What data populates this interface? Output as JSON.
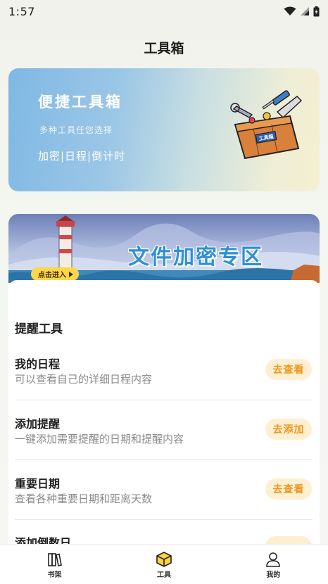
{
  "status_bar": {
    "time": "1:57"
  },
  "header": {
    "title": "工具箱"
  },
  "hero": {
    "title": "便捷工具箱",
    "subtitle": "多种工具任您选择",
    "tags": "加密|日程|倒计时",
    "illustration_label": "工具箱"
  },
  "banner": {
    "title": "文件加密专区",
    "button_label": "点击进入"
  },
  "section": {
    "title": "提醒工具",
    "items": [
      {
        "name": "我的日程",
        "desc": "可以查看自己的详细日程内容",
        "action": "去查看"
      },
      {
        "name": "添加提醒",
        "desc": "一键添加需要提醒的日期和提醒内容",
        "action": "去添加"
      },
      {
        "name": "重要日期",
        "desc": "查看各种重要日期和距离天数",
        "action": "去查看"
      },
      {
        "name": "添加倒数日",
        "desc": "",
        "action": ""
      }
    ]
  },
  "bottom_nav": {
    "items": [
      {
        "label": "书架",
        "icon": "bookshelf-icon"
      },
      {
        "label": "工具",
        "icon": "toolbox-cube-icon",
        "active": true
      },
      {
        "label": "我的",
        "icon": "person-icon"
      }
    ]
  },
  "colors": {
    "accent": "#f0951a",
    "accent_bg": "#fdf0d2",
    "active_nav": "#ffd33d"
  }
}
